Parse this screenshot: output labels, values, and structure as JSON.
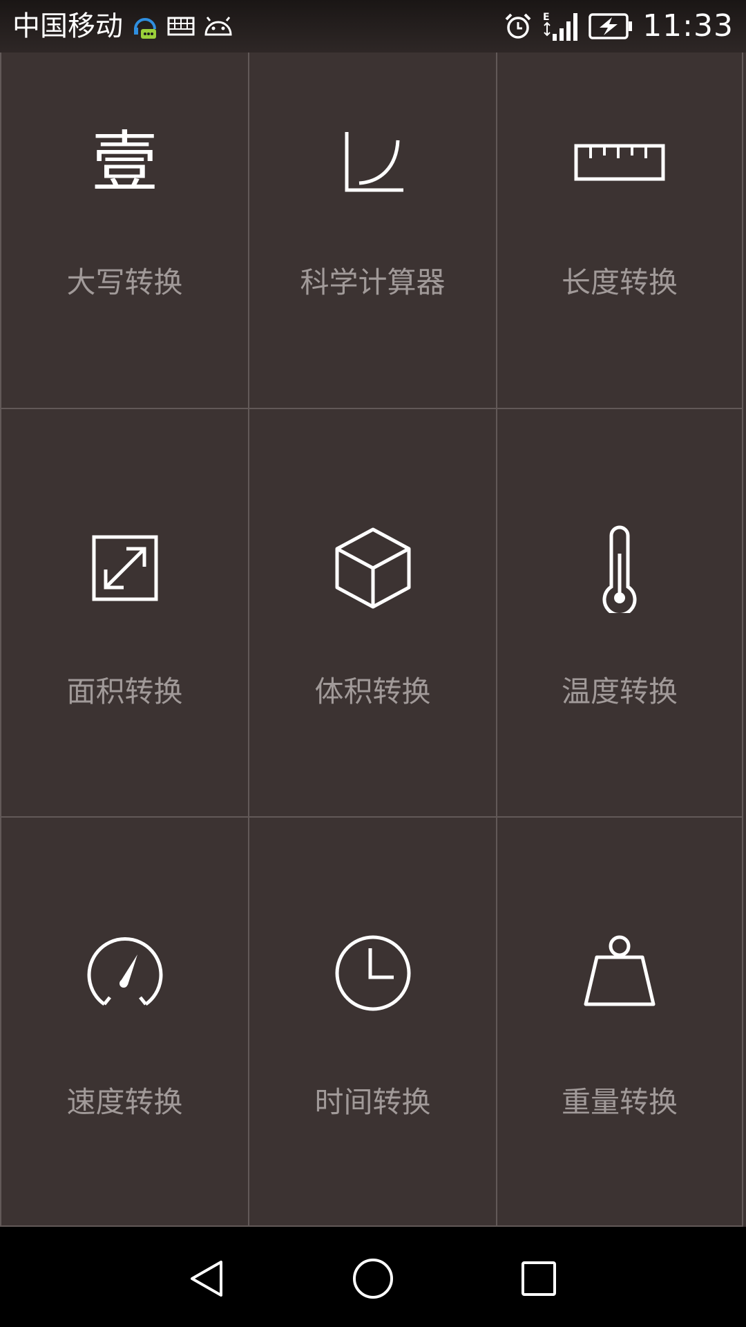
{
  "status_bar": {
    "carrier": "中国移动",
    "time": "11:33",
    "icons": [
      "assistant-icon",
      "keyboard-icon",
      "android-icon",
      "alarm-icon",
      "signal-e-icon",
      "battery-charging-icon"
    ]
  },
  "grid": {
    "tiles": [
      {
        "label": "大写转换",
        "icon": "chinese-numeral-icon",
        "glyph": "壹"
      },
      {
        "label": "科学计算器",
        "icon": "curve-graph-icon"
      },
      {
        "label": "长度转换",
        "icon": "ruler-icon"
      },
      {
        "label": "面积转换",
        "icon": "resize-square-icon"
      },
      {
        "label": "体积转换",
        "icon": "cube-icon"
      },
      {
        "label": "温度转换",
        "icon": "thermometer-icon"
      },
      {
        "label": "速度转换",
        "icon": "speedometer-icon"
      },
      {
        "label": "时间转换",
        "icon": "clock-icon"
      },
      {
        "label": "重量转换",
        "icon": "weight-icon"
      }
    ]
  },
  "nav_bar": {
    "buttons": [
      "back-icon",
      "home-icon",
      "recents-icon"
    ]
  },
  "colors": {
    "background": "#3c3332",
    "grid_line": "#625958",
    "label": "#a19a99",
    "icon": "#ffffff",
    "nav_background": "#000000"
  }
}
